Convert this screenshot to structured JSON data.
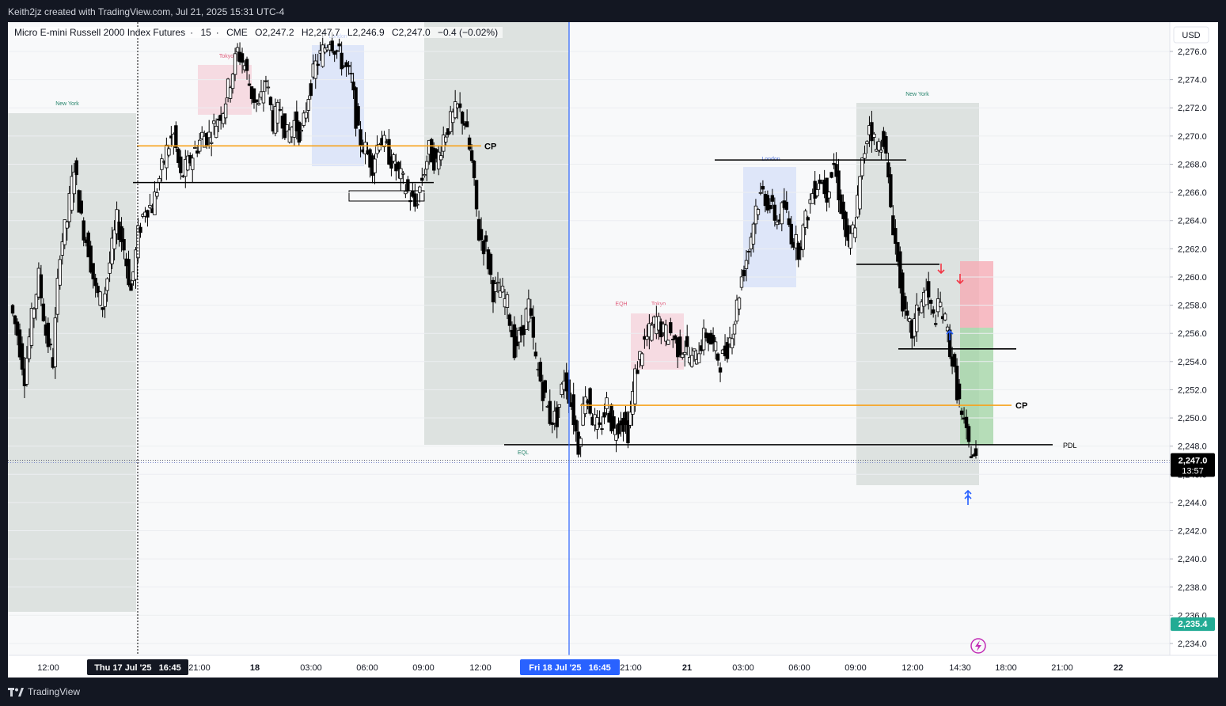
{
  "header": {
    "byline": "Keith2jz created with TradingView.com, Jul 21, 2025 15:31 UTC-4"
  },
  "legend": {
    "symbol": "Micro E-mini Russell 2000 Index Futures",
    "interval": "15",
    "exchange": "CME",
    "open": "O2,247.2",
    "high": "H2,247.7",
    "low": "L2,246.9",
    "close": "C2,247.0",
    "change": "−0.4 (−0.02%)"
  },
  "footer": {
    "brand": "TradingView"
  },
  "chart_data": {
    "type": "candlestick",
    "currency": "USD",
    "ylim": [
      2233,
      2278
    ],
    "y_ticks": [
      "2,234.0",
      "2,236.0",
      "2,238.0",
      "2,240.0",
      "2,242.0",
      "2,244.0",
      "2,246.0",
      "2,248.0",
      "2,250.0",
      "2,252.0",
      "2,254.0",
      "2,256.0",
      "2,258.0",
      "2,260.0",
      "2,262.0",
      "2,264.0",
      "2,266.0",
      "2,268.0",
      "2,270.0",
      "2,272.0",
      "2,274.0",
      "2,276.0"
    ],
    "x_ticks": [
      "12:00",
      "",
      "21:00",
      "18",
      "03:00",
      "06:00",
      "09:00",
      "12:00",
      "",
      "21:00",
      "21",
      "03:00",
      "06:00",
      "09:00",
      "12:00",
      "14:30",
      "18:00",
      "21:00",
      "22"
    ],
    "crosshair_labels": [
      {
        "text": "Thu 17 Jul '25   16:45",
        "style": "dark"
      },
      {
        "text": "Fri 18 Jul '25   16:45",
        "style": "blue"
      }
    ],
    "last_price": {
      "value": "2,247.0",
      "countdown": "13:57",
      "level": 2247.0
    },
    "target_price": {
      "value": "2,235.4",
      "level": 2235.4
    },
    "colors": {
      "up": "#ffffff",
      "down": "#000000",
      "orange": "#f7a21b",
      "blue": "#2962ff",
      "green_label": "#22ab94",
      "red_zone": "#f7a7b1",
      "green_zone": "#a5d6a7"
    },
    "levels": [
      {
        "label": "CP",
        "value": 2269.3,
        "color": "#f7a21b",
        "x0": "Thu 18:00",
        "x1": "Fri 09:00"
      },
      {
        "label": "",
        "value": 2266.7,
        "color": "#000000",
        "x0": "Thu 18:00",
        "x1": "Fri 09:00"
      },
      {
        "label": "CP",
        "value": 2250.9,
        "color": "#f7a21b",
        "x0": "Fri 16:45",
        "x1": "Mon 17:15"
      },
      {
        "label": "PDL",
        "value": 2248.1,
        "color": "#000000",
        "x0": "Fri 13:00",
        "x1": "Mon 18:00"
      },
      {
        "label": "",
        "value": 2268.3,
        "color": "#000000",
        "x0": "Mon 01:30",
        "x1": "Mon 11:00"
      },
      {
        "label": "",
        "value": 2260.9,
        "color": "#000000",
        "x0": "Mon 09:00",
        "x1": "Mon 13:30"
      },
      {
        "label": "",
        "value": 2254.9,
        "color": "#000000",
        "x0": "Mon 12:00",
        "x1": "Mon 17:30"
      }
    ],
    "sessions": [
      {
        "label": "New York",
        "kind": "gray"
      },
      {
        "label": "Tokyo",
        "kind": "pink"
      },
      {
        "label": "London",
        "kind": "blue"
      },
      {
        "label": "Tokyo",
        "kind": "pink"
      },
      {
        "label": "London",
        "kind": "blue"
      },
      {
        "label": "New York",
        "kind": "gray"
      }
    ],
    "annotations": [
      "EQH",
      "EQL"
    ],
    "price_path": [
      2258,
      2256,
      2253,
      2257,
      2260,
      2256,
      2254,
      2262,
      2264,
      2268,
      2264,
      2262,
      2259,
      2258,
      2261,
      2264,
      2262,
      2259,
      2263,
      2265,
      2265,
      2267,
      2269,
      2270,
      2267,
      2268,
      2269,
      2270,
      2270,
      2271,
      2272,
      2274,
      2276,
      2275,
      2273,
      2272,
      2274,
      2271,
      2272,
      2270,
      2271,
      2270,
      2273,
      2275,
      2276,
      2277,
      2276,
      2275,
      2274,
      2270,
      2269,
      2268,
      2270,
      2269,
      2268,
      2267,
      2266,
      2265,
      2267,
      2269,
      2268,
      2270,
      2271,
      2272,
      2271,
      2268,
      2263,
      2262,
      2259,
      2259,
      2258,
      2255,
      2256,
      2258,
      2254,
      2252,
      2250,
      2250,
      2253,
      2251,
      2248,
      2252,
      2250,
      2249,
      2251,
      2249,
      2250,
      2249,
      2253,
      2255,
      2256,
      2257,
      2256,
      2256,
      2255,
      2255,
      2254,
      2255,
      2256,
      2255,
      2254,
      2255,
      2257,
      2260,
      2262,
      2265,
      2266,
      2265,
      2264,
      2265,
      2263,
      2262,
      2264,
      2266,
      2267,
      2266,
      2268,
      2265,
      2262,
      2264,
      2268,
      2271,
      2269,
      2270,
      2265,
      2261,
      2257,
      2256,
      2258,
      2259,
      2257,
      2258,
      2256,
      2253,
      2250,
      2248,
      2247
    ]
  }
}
